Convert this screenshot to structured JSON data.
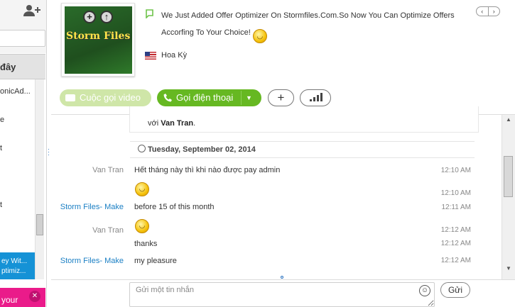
{
  "sidebar": {
    "recent_label": "đây",
    "contacts": [
      "onicAd...",
      "e",
      "t",
      "t"
    ],
    "selected_item": [
      "ey Wit...",
      "ptimiz..."
    ],
    "promo_text": "your"
  },
  "header": {
    "avatar_title": "Storm Files",
    "mood_message": "We Just Added Offer Optimizer On Stormfiles.Com.So Now You Can Optimize Offers Accorfing To Your Choice!",
    "country": "Hoa Kỳ"
  },
  "actions": {
    "video_call_label": "Cuộc gọi video",
    "call_label": "Gọi điện thoại",
    "call_dropdown_icon": "▼",
    "add_icon": "+"
  },
  "chat": {
    "previous_message": {
      "prefix": "với",
      "name": "Van Tran",
      "suffix": "."
    },
    "date_header": "Tuesday, September 02, 2014",
    "messages": [
      {
        "sender": "Van Tran",
        "text": "Hết tháng này thì khi nào được pay admin",
        "time": "12:10 AM"
      },
      {
        "sender": "",
        "text": "",
        "emoji": "smile",
        "time": "12:10 AM"
      },
      {
        "sender": "Storm Files- Make",
        "text": "before 15 of this month",
        "time": "12:11 AM"
      },
      {
        "sender": "Van Tran",
        "text": "",
        "emoji": "smile",
        "time": "12:12 AM"
      },
      {
        "sender": "",
        "text": "thanks",
        "time": "12:12 AM"
      },
      {
        "sender": "Storm Files- Make",
        "text": "my pleasure",
        "time": "12:12 AM"
      }
    ]
  },
  "composer": {
    "placeholder": "Gửi một tin nhắn",
    "send_label": "Gửi"
  },
  "colors": {
    "accent_green": "#66b822",
    "selection_blue": "#1592d6",
    "promo_pink": "#ea1b8a",
    "link_blue": "#1a7fc4"
  }
}
